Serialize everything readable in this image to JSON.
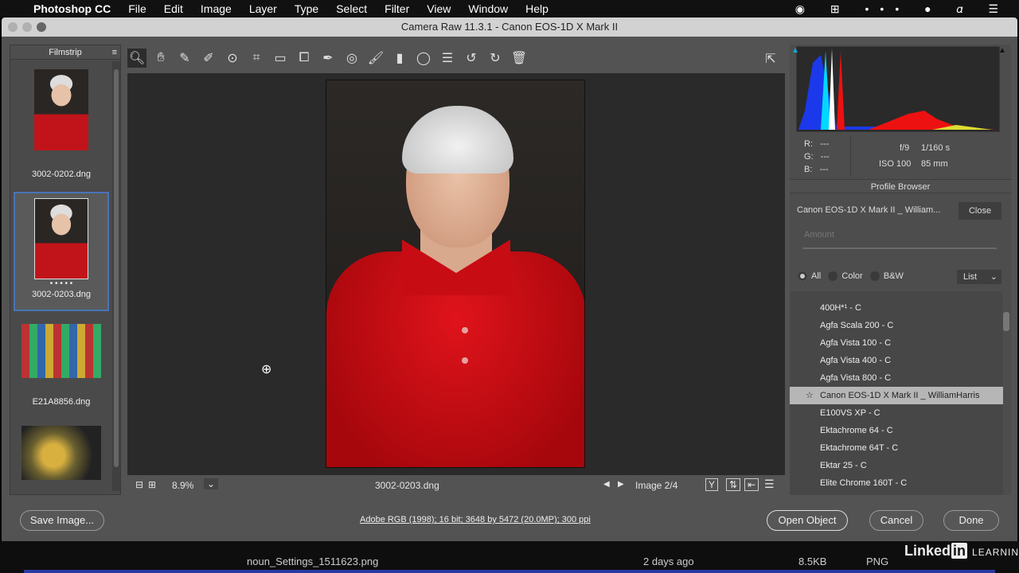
{
  "menubar": {
    "app": "Photoshop CC",
    "items": [
      "File",
      "Edit",
      "Image",
      "Layer",
      "Type",
      "Select",
      "Filter",
      "View",
      "Window",
      "Help"
    ]
  },
  "window": {
    "title": "Camera Raw 11.3.1  -  Canon EOS-1D X Mark II"
  },
  "filmstrip": {
    "title": "Filmstrip",
    "items": [
      {
        "name": "3002-0202.dng"
      },
      {
        "name": "3002-0203.dng",
        "selected": true,
        "rating_dots": "• • • • •"
      },
      {
        "name": "E21A8856.dng"
      },
      {
        "name": ""
      }
    ]
  },
  "toolbar": {
    "tools": [
      "zoom-icon",
      "hand-icon",
      "white-balance-icon",
      "color-sampler-icon",
      "targeted-adjustment-icon",
      "crop-icon",
      "straighten-icon",
      "transform-icon",
      "spot-removal-icon",
      "red-eye-icon",
      "adjustment-brush-icon",
      "graduated-filter-icon",
      "radial-filter-icon",
      "presets-list-icon",
      "rotate-left-icon",
      "rotate-right-icon",
      "trash-icon"
    ]
  },
  "preview": {
    "zoom": "8.9%",
    "filename": "3002-0203.dng",
    "image_counter": "Image 2/4"
  },
  "info": {
    "r": "R:",
    "g": "G:",
    "b": "B:",
    "rv": "---",
    "gv": "---",
    "bv": "---",
    "aperture": "f/9",
    "shutter": "1/160 s",
    "iso": "ISO 100",
    "focal": "85 mm"
  },
  "profile_browser": {
    "title": "Profile Browser",
    "current": "Canon EOS-1D X Mark II _ William...",
    "close": "Close",
    "amount_placeholder": "Amount",
    "filters": [
      "All",
      "Color",
      "B&W"
    ],
    "view": "List",
    "items": [
      "400H*¹ - C",
      "Agfa Scala 200 - C",
      "Agfa Vista 100 - C",
      "Agfa Vista 400 - C",
      "Agfa Vista 800 - C",
      "Canon EOS-1D X Mark II _ WilliamHarris",
      "E100VS XP - C",
      "Ektachrome 64 - C",
      "Ektachrome 64T - C",
      "Ektar 25 - C",
      "Elite Chrome 160T - C"
    ],
    "selected_index": 5
  },
  "bottom": {
    "save": "Save Image...",
    "workflow": "Adobe RGB (1998); 16 bit; 3648 by 5472 (20.0MP); 300 ppi",
    "open": "Open Object",
    "cancel": "Cancel",
    "done": "Done"
  },
  "finder": {
    "file": "noun_Settings_1511623.png",
    "date": "2 days ago",
    "size": "8.5KB",
    "kind": "PNG",
    "brand": "Linked",
    "brand_in": "in",
    "brand_learning": "LEARNING"
  }
}
